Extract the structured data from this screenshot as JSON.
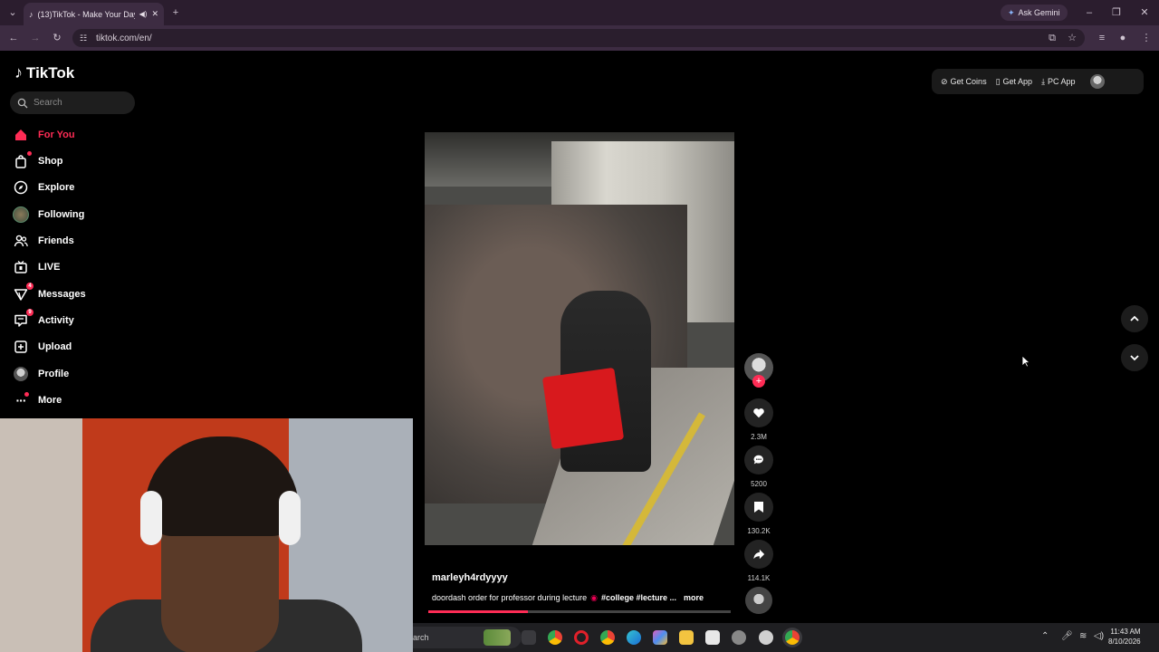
{
  "browser": {
    "tab_title": "(13)TikTok - Make Your Day",
    "url": "tiktok.com/en/",
    "gemini_label": "Ask Gemini"
  },
  "sidebar": {
    "logo_text": "TikTok",
    "search_placeholder": "Search",
    "items": [
      {
        "label": "For You",
        "icon": "home-icon",
        "active": true
      },
      {
        "label": "Shop",
        "icon": "shopping-bag-icon"
      },
      {
        "label": "Explore",
        "icon": "compass-icon"
      },
      {
        "label": "Following",
        "icon": "following-avatar-icon"
      },
      {
        "label": "Friends",
        "icon": "friends-icon"
      },
      {
        "label": "LIVE",
        "icon": "live-icon"
      },
      {
        "label": "Messages",
        "icon": "messages-icon",
        "badge": "4"
      },
      {
        "label": "Activity",
        "icon": "activity-icon",
        "badge": "9"
      },
      {
        "label": "Upload",
        "icon": "upload-icon"
      },
      {
        "label": "Profile",
        "icon": "profile-avatar-icon"
      },
      {
        "label": "More",
        "icon": "more-icon"
      }
    ]
  },
  "top_actions": {
    "get_coins": "Get Coins",
    "get_app": "Get App",
    "pc_app": "PC App"
  },
  "video": {
    "author": "marleyh4rdyyyy",
    "caption": "doordash order for professor during lecture",
    "hashtags": "#college #lecture ...",
    "more_label": "more",
    "progress": 0.33
  },
  "actions": {
    "likes": "2.3M",
    "comments": "5200",
    "saves": "130.2K",
    "shares": "114.1K"
  },
  "taskbar": {
    "search_fragment": "arch",
    "time": "11:43 AM",
    "date": "8/10/2026"
  },
  "colors": {
    "accent": "#fe2c55",
    "chrome_tab": "#3d2c42",
    "chrome_bar": "#2b1d2e"
  }
}
